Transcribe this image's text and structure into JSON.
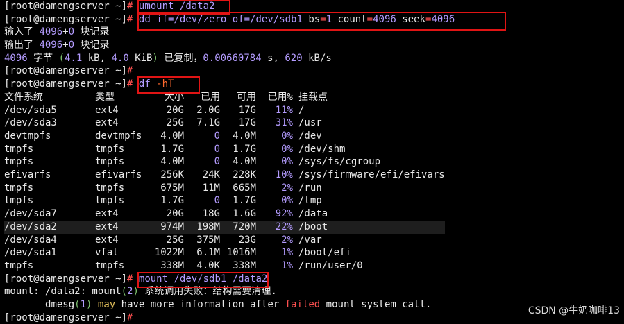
{
  "prompt": "[root@damengserver ~]#",
  "cmd1": "umount /data2",
  "cmd2": {
    "dd": "dd ",
    "if_key": "if",
    "if_val": "=/dev/zero ",
    "of_key": "of",
    "of_val": "=/dev/sdb1 ",
    "bs_key": "bs",
    "bs_eq": "=",
    "bs_val": "1",
    "count_key": " count",
    "count_eq": "=",
    "count_val": "4096",
    "seek_key": " seek",
    "seek_eq": "=",
    "seek_val": "4096"
  },
  "dd_out1": {
    "pre": "输入了 ",
    "num": "4096",
    "plus": "+",
    "zero": "0",
    "post": " 块记录"
  },
  "dd_out2": {
    "pre": "输出了 ",
    "num": "4096",
    "plus": "+",
    "zero": "0",
    "post": " 块记录"
  },
  "dd_out3": {
    "n1": "4096",
    "t1": " 字节 ",
    "p1": "(",
    "n2": "4.1",
    "t2": " kB, ",
    "n3": "4.0",
    "t3": " KiB",
    "p2": ")",
    "t4": " 已复制，",
    "n4": "0.00660784",
    "t5": " s, ",
    "n5": "620",
    "t6": " kB/s"
  },
  "cmd3": {
    "df": "df ",
    "flag": "-hT"
  },
  "df_header": [
    "文件系统",
    "类型",
    "大小",
    "已用",
    "可用",
    "已用%",
    "挂载点"
  ],
  "df_rows": [
    [
      "/dev/sda5",
      "ext4",
      "20G",
      "2.0G",
      "17G",
      "11%",
      "/"
    ],
    [
      "/dev/sda3",
      "ext4",
      "25G",
      "7.1G",
      "17G",
      "31%",
      "/usr"
    ],
    [
      "devtmpfs",
      "devtmpfs",
      "4.0M",
      "0",
      "4.0M",
      "0%",
      "/dev"
    ],
    [
      "tmpfs",
      "tmpfs",
      "1.7G",
      "0",
      "1.7G",
      "0%",
      "/dev/shm"
    ],
    [
      "tmpfs",
      "tmpfs",
      "4.0M",
      "0",
      "4.0M",
      "0%",
      "/sys/fs/cgroup"
    ],
    [
      "efivarfs",
      "efivarfs",
      "256K",
      "24K",
      "228K",
      "10%",
      "/sys/firmware/efi/efivars"
    ],
    [
      "tmpfs",
      "tmpfs",
      "675M",
      "11M",
      "665M",
      "2%",
      "/run"
    ],
    [
      "tmpfs",
      "tmpfs",
      "1.7G",
      "0",
      "1.7G",
      "0%",
      "/tmp"
    ],
    [
      "/dev/sda7",
      "ext4",
      "20G",
      "18G",
      "1.6G",
      "92%",
      "/data"
    ],
    [
      "/dev/sda2",
      "ext4",
      "974M",
      "198M",
      "720M",
      "22%",
      "/boot"
    ],
    [
      "/dev/sda4",
      "ext4",
      "25G",
      "375M",
      "23G",
      "2%",
      "/var"
    ],
    [
      "/dev/sda1",
      "vfat",
      "1022M",
      "6.1M",
      "1016M",
      "1%",
      "/boot/efi"
    ],
    [
      "tmpfs",
      "tmpfs",
      "338M",
      "4.0K",
      "338M",
      "1%",
      "/run/user/0"
    ]
  ],
  "cmd4": "mount /dev/sdb1 /data2",
  "mount_err1": {
    "a": "mount: /data2: mount",
    "p1": "(",
    "n": "2",
    "p2": ")",
    "b": " 系统调用失败：结构需要清理."
  },
  "mount_err2": {
    "indent": "       ",
    "a": "dmesg",
    "p1": "(",
    "n": "1",
    "p2": ")",
    "sp": " ",
    "may": "may",
    "b": " have more information after ",
    "failed": "failed",
    "c": " mount system call."
  },
  "watermark": "CSDN @牛奶咖啡13",
  "colors": {
    "prompt_hash": "#ff5050",
    "number": "#b49cff",
    "keyword": "#7ec16f",
    "highlight_box": "#e01414"
  }
}
